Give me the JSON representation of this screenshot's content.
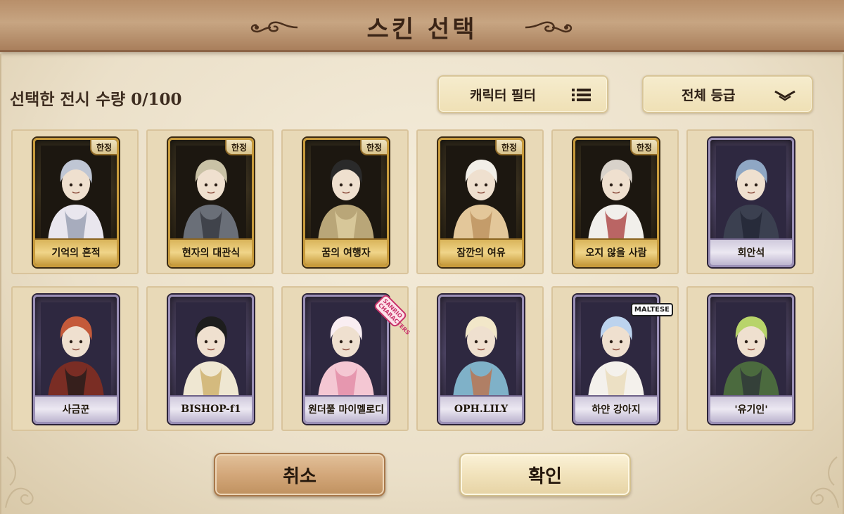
{
  "header": {
    "title": "스킨 선택"
  },
  "toolbar": {
    "count_label": "선택한 전시 수량 0/100",
    "filter_label": "캐릭터 필터",
    "grade_label": "전체 등급"
  },
  "skins": [
    {
      "name": "기억의 흔적",
      "badge": "한정",
      "frame": "gold"
    },
    {
      "name": "현자의 대관식",
      "badge": "한정",
      "frame": "gold"
    },
    {
      "name": "꿈의 여행자",
      "badge": "한정",
      "frame": "gold"
    },
    {
      "name": "잠깐의 여유",
      "badge": "한정",
      "frame": "gold"
    },
    {
      "name": "오지 않을 사람",
      "badge": "한정",
      "frame": "gold"
    },
    {
      "name": "회안석",
      "badge": "",
      "frame": "purple"
    },
    {
      "name": "사금꾼",
      "badge": "",
      "frame": "purple"
    },
    {
      "name": "BISHOP-f1",
      "badge": "",
      "frame": "purple"
    },
    {
      "name": "원더풀 마이멜로디",
      "badge": "",
      "frame": "purple",
      "sticker": "SANRIO CHARACTERS"
    },
    {
      "name": "OPH.LILY",
      "badge": "",
      "frame": "purple"
    },
    {
      "name": "하얀 강아지",
      "badge": "",
      "frame": "purple",
      "sticker": "MALTESE"
    },
    {
      "name": "'유기인'",
      "badge": "",
      "frame": "purple"
    }
  ],
  "buttons": {
    "cancel": "취소",
    "confirm": "확인"
  },
  "colors": {
    "header": "#b88f6a",
    "gold_frame": "#c89b3c",
    "purple_frame": "#9a8fb6",
    "parchment": "#efe6d2"
  },
  "icons": {
    "filter": "list-icon",
    "grade": "chevron-down-icon"
  }
}
